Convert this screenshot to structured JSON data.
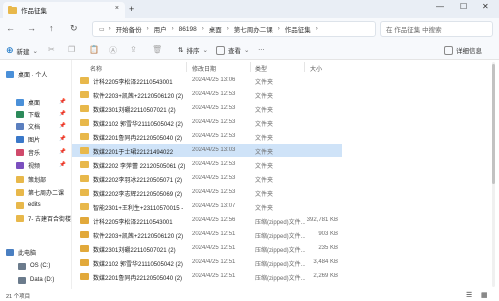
{
  "window": {
    "tab_title": "作品征集",
    "tab_close": "×",
    "new_tab": "+",
    "minimize": "—",
    "maximize": "☐",
    "close": "✕"
  },
  "nav": {
    "back": "←",
    "forward": "→",
    "up": "↑",
    "refresh": "↻",
    "breadcrumbs": [
      "开始备份",
      "用户",
      "86198",
      "桌面",
      "第七周办二课",
      "作品征集"
    ],
    "more": "…",
    "search_placeholder": "在 作品征集 中搜索"
  },
  "toolbar": {
    "new_label": "新建",
    "sort_label": "排序",
    "view_label": "查看",
    "more": "…",
    "details_label": "详细信息"
  },
  "sidebar": {
    "items": [
      {
        "label": "桌面 · 个人",
        "color": "#4a90d9",
        "pin": ""
      },
      {
        "label": "桌面",
        "color": "#4a90d9",
        "pin": "📌"
      },
      {
        "label": "下载",
        "color": "#2c8a5a",
        "pin": "📌"
      },
      {
        "label": "文档",
        "color": "#5b7fbf",
        "pin": "📌"
      },
      {
        "label": "图片",
        "color": "#3a78c9",
        "pin": "📌"
      },
      {
        "label": "音乐",
        "color": "#d04a6b",
        "pin": "📌"
      },
      {
        "label": "视频",
        "color": "#7b4fbf",
        "pin": "📌"
      },
      {
        "label": "策划部",
        "color": "#e8b84b",
        "pin": ""
      },
      {
        "label": "第七周办二课",
        "color": "#e8b84b",
        "pin": ""
      },
      {
        "label": "edits",
        "color": "#e8b84b",
        "pin": ""
      },
      {
        "label": "7- 古建百合街楼",
        "color": "#e8b84b",
        "pin": ""
      },
      {
        "label": "此电脑",
        "color": "#4a7fc1",
        "pin": ""
      },
      {
        "label": "OS (C:)",
        "color": "#6b7b8c",
        "pin": ""
      },
      {
        "label": "Data (D:)",
        "color": "#6b7b8c",
        "pin": ""
      }
    ]
  },
  "columns": {
    "name": "名称",
    "date": "修改日期",
    "type": "类型",
    "size": "大小"
  },
  "files": [
    {
      "name": "计科2205李松泽22110543001",
      "date": "2024/4/25 13:06",
      "type": "文件夹",
      "size": "",
      "zip": false
    },
    {
      "name": "软件2203+凯茜+22120506120 (2)",
      "date": "2024/4/25 12:53",
      "type": "文件夹",
      "size": "",
      "zip": false
    },
    {
      "name": "数媒2301刘硼22110507021 (2)",
      "date": "2024/4/25 12:53",
      "type": "文件夹",
      "size": "",
      "zip": false
    },
    {
      "name": "数媒2102 郭雪华21110505042 (2)",
      "date": "2024/4/25 12:53",
      "type": "文件夹",
      "size": "",
      "zip": false
    },
    {
      "name": "数媒2201鲁同冉22120505040 (2)",
      "date": "2024/4/25 12:53",
      "type": "文件夹",
      "size": "",
      "zip": false
    },
    {
      "name": "数媒2201于士珺22121494022",
      "date": "2024/4/25 13:03",
      "type": "文件夹",
      "size": "",
      "zip": false
    },
    {
      "name": "数媒2202 李萍蕾 22120505061 (2)",
      "date": "2024/4/25 12:53",
      "type": "文件夹",
      "size": "",
      "zip": false
    },
    {
      "name": "数媒2202李羽冰22120505071 (2)",
      "date": "2024/4/25 12:53",
      "type": "文件夹",
      "size": "",
      "zip": false
    },
    {
      "name": "数媒2202李志辉22120505069 (2)",
      "date": "2024/4/25 12:53",
      "type": "文件夹",
      "size": "",
      "zip": false
    },
    {
      "name": "智能2301+王利生+23110570015 - 复...",
      "date": "2024/4/25 13:07",
      "type": "文件夹",
      "size": "",
      "zip": false
    },
    {
      "name": "计科2205李松泽22110543001",
      "date": "2024/4/25 12:56",
      "type": "压缩(zipped)文件...",
      "size": "392,781 KB",
      "zip": true
    },
    {
      "name": "软件2203+凯茜+22120506120 (2)",
      "date": "2024/4/25 12:51",
      "type": "压缩(zipped)文件...",
      "size": "903 KB",
      "zip": true
    },
    {
      "name": "数媒2301刘硼22110507021 (2)",
      "date": "2024/4/25 12:51",
      "type": "压缩(zipped)文件...",
      "size": "235 KB",
      "zip": true
    },
    {
      "name": "数媒2102 郭雪华21110505042 (2)",
      "date": "2024/4/25 12:51",
      "type": "压缩(zipped)文件...",
      "size": "3,484 KB",
      "zip": true
    },
    {
      "name": "数媒2201鲁同冉22120505040 (2)",
      "date": "2024/4/25 12:51",
      "type": "压缩(zipped)文件...",
      "size": "2,269 KB",
      "zip": true
    }
  ],
  "status": {
    "count": "21 个项目"
  },
  "colors": {
    "folder": "#e8b84b",
    "zip": "#e2a93b",
    "selected_row": "#cfe3f8",
    "accent": "#0067c0"
  }
}
